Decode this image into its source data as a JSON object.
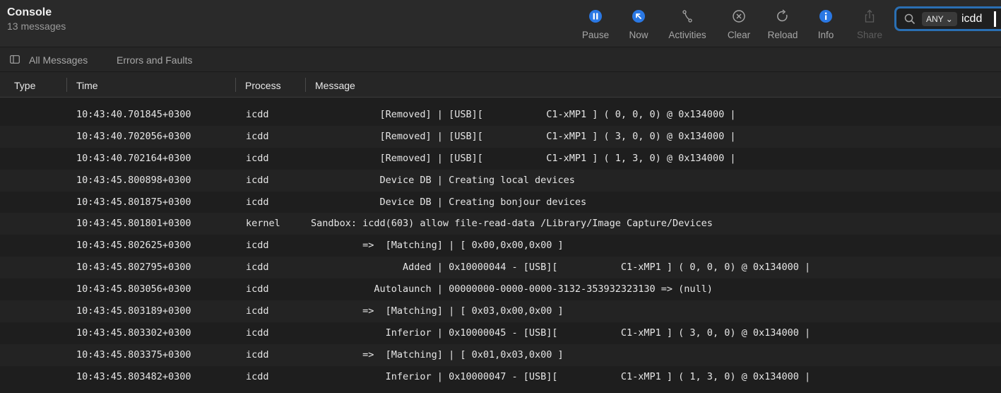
{
  "app": {
    "title": "Console",
    "subtitle": "13 messages"
  },
  "toolbar": {
    "pause": "Pause",
    "now": "Now",
    "activities": "Activities",
    "clear": "Clear",
    "reload": "Reload",
    "info": "Info",
    "share": "Share"
  },
  "search": {
    "scope": "ANY ⌄",
    "query": "icdd"
  },
  "filters": {
    "all": "All Messages",
    "errors": "Errors and Faults"
  },
  "columns": {
    "type": "Type",
    "time": "Time",
    "process": "Process",
    "message": "Message"
  },
  "colors": {
    "accent": "#2a78e4",
    "search_border": "#2a6fb3"
  },
  "rows": [
    {
      "time": "10:43:40.701845+0300",
      "process": "icdd",
      "message": "            [Removed] | [USB][           C1-xMP1 ] ( 0, 0, 0) @ 0x134000 |"
    },
    {
      "time": "10:43:40.702056+0300",
      "process": "icdd",
      "message": "            [Removed] | [USB][           C1-xMP1 ] ( 3, 0, 0) @ 0x134000 |"
    },
    {
      "time": "10:43:40.702164+0300",
      "process": "icdd",
      "message": "            [Removed] | [USB][           C1-xMP1 ] ( 1, 3, 0) @ 0x134000 |"
    },
    {
      "time": "10:43:45.800898+0300",
      "process": "icdd",
      "message": "            Device DB | Creating local devices"
    },
    {
      "time": "10:43:45.801875+0300",
      "process": "icdd",
      "message": "            Device DB | Creating bonjour devices"
    },
    {
      "time": "10:43:45.801801+0300",
      "process": "kernel",
      "message": "Sandbox: icdd(603) allow file-read-data /Library/Image Capture/Devices"
    },
    {
      "time": "10:43:45.802625+0300",
      "process": "icdd",
      "message": "         =>  [Matching] | [ 0x00,0x00,0x00 ]"
    },
    {
      "time": "10:43:45.802795+0300",
      "process": "icdd",
      "message": "                Added | 0x10000044 - [USB][           C1-xMP1 ] ( 0, 0, 0) @ 0x134000 |"
    },
    {
      "time": "10:43:45.803056+0300",
      "process": "icdd",
      "message": "           Autolaunch | 00000000-0000-0000-3132-353932323130 => (null)"
    },
    {
      "time": "10:43:45.803189+0300",
      "process": "icdd",
      "message": "         =>  [Matching] | [ 0x03,0x00,0x00 ]"
    },
    {
      "time": "10:43:45.803302+0300",
      "process": "icdd",
      "message": "             Inferior | 0x10000045 - [USB][           C1-xMP1 ] ( 3, 0, 0) @ 0x134000 |"
    },
    {
      "time": "10:43:45.803375+0300",
      "process": "icdd",
      "message": "         =>  [Matching] | [ 0x01,0x03,0x00 ]"
    },
    {
      "time": "10:43:45.803482+0300",
      "process": "icdd",
      "message": "             Inferior | 0x10000047 - [USB][           C1-xMP1 ] ( 1, 3, 0) @ 0x134000 |"
    }
  ]
}
